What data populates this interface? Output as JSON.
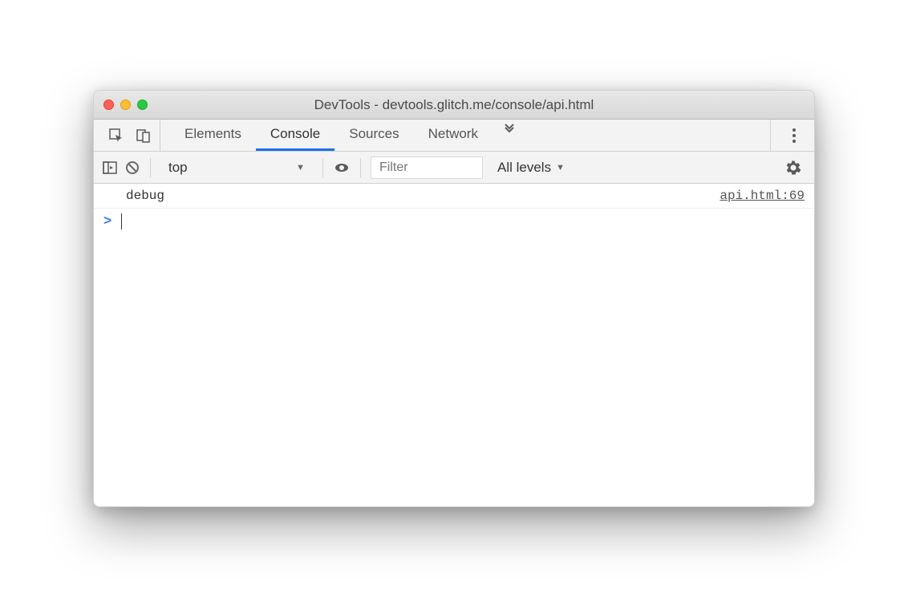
{
  "window": {
    "title": "DevTools - devtools.glitch.me/console/api.html"
  },
  "tabs": {
    "items": [
      "Elements",
      "Console",
      "Sources",
      "Network"
    ],
    "active_index": 1
  },
  "toolbar": {
    "context": "top",
    "filter_placeholder": "Filter",
    "levels": "All levels"
  },
  "console": {
    "logs": [
      {
        "message": "debug",
        "source": "api.html:69"
      }
    ],
    "prompt": ">"
  }
}
